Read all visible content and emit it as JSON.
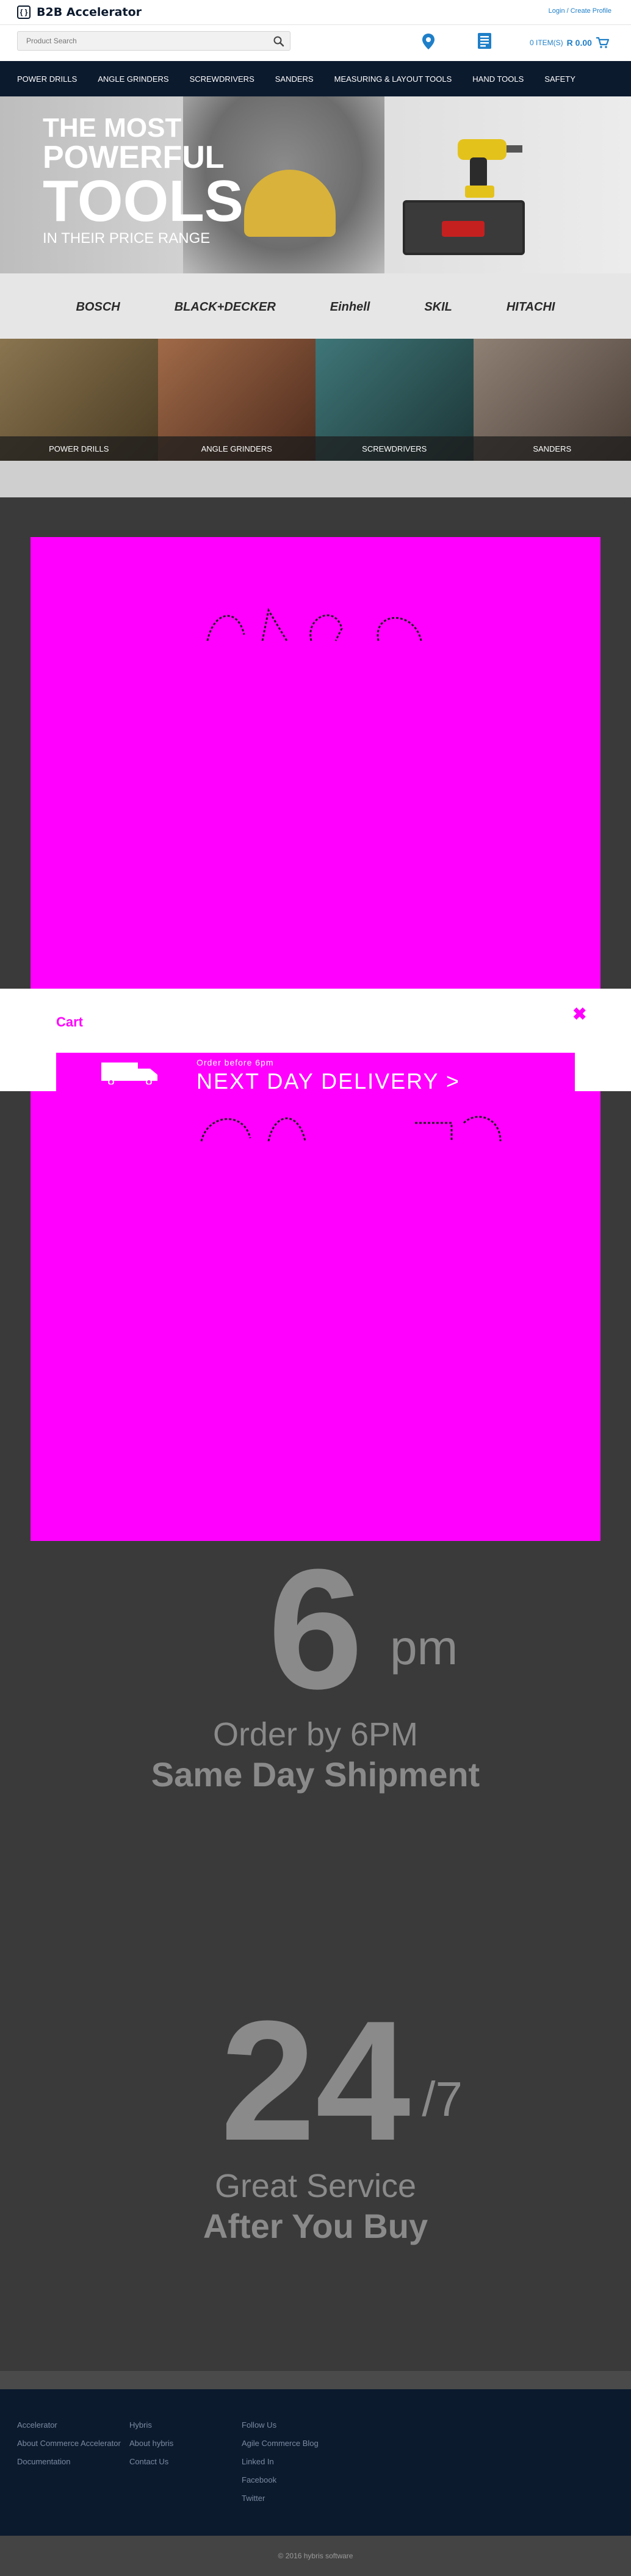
{
  "header": {
    "logo_mark": "{ }",
    "logo_text": "B2B Accelerator",
    "login_link": "Login / Create Profile"
  },
  "search": {
    "placeholder": "Product Search",
    "value": ""
  },
  "cart": {
    "items_label": "0 ITEM(S)",
    "total": "R 0.00"
  },
  "nav": {
    "items": [
      "POWER DRILLS",
      "ANGLE GRINDERS",
      "SCREWDRIVERS",
      "SANDERS",
      "MEASURING & LAYOUT TOOLS",
      "HAND TOOLS",
      "SAFETY"
    ]
  },
  "hero": {
    "line1": "THE MOST",
    "line2": "POWERFUL",
    "line3": "TOOLS",
    "line4": "IN THEIR PRICE RANGE"
  },
  "brands": [
    "BOSCH",
    "BLACK+DECKER",
    "Einhell",
    "SKIL",
    "HITACHI"
  ],
  "categories": [
    {
      "label": "POWER DRILLS",
      "color": "#6b5a3a"
    },
    {
      "label": "ANGLE GRINDERS",
      "color": "#7a4a32"
    },
    {
      "label": "SCREWDRIVERS",
      "color": "#2f5a5c"
    },
    {
      "label": "SANDERS",
      "color": "#6e6058"
    }
  ],
  "modal": {
    "title": "Cart",
    "close_glyph": "✖",
    "banner_small": "Order before 6pm",
    "banner_title": "NEXT DAY DELIVERY >"
  },
  "features": [
    {
      "big": "6",
      "sup": "pm",
      "line1": "Order by 6PM",
      "line2": "Same Day Shipment"
    },
    {
      "big": "24",
      "sup": "/7",
      "line1": "Great Service",
      "line2": "After You Buy"
    }
  ],
  "footer": {
    "col1": [
      "Accelerator",
      "About Commerce Accelerator",
      "Documentation"
    ],
    "col2": [
      "Hybris",
      "About hybris",
      "Contact Us"
    ],
    "col3": [
      "Follow Us",
      "Agile Commerce Blog",
      "Linked In",
      "Facebook",
      "Twitter"
    ],
    "copyright": "© 2016 hybris software"
  },
  "colors": {
    "navy": "#0c1a2e",
    "accent_blue": "#1f7fc8",
    "magenta": "#ff00ff"
  }
}
